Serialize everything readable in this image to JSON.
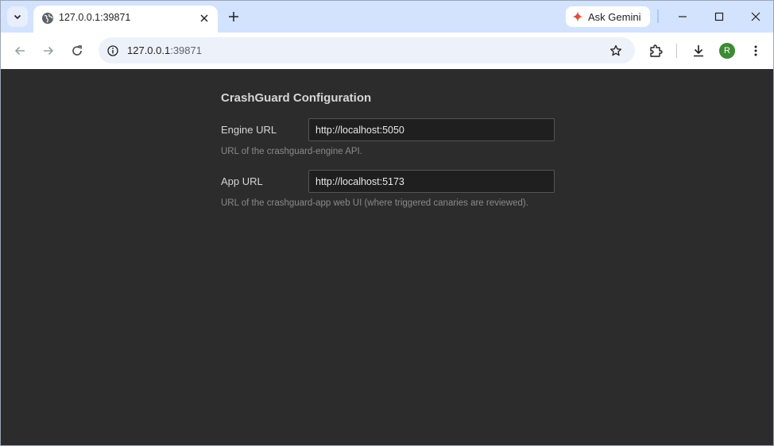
{
  "browser": {
    "tab": {
      "title": "127.0.0.1:39871"
    },
    "gemini_label": "Ask Gemini",
    "address": {
      "host": "127.0.0.1",
      "port": ":39871"
    },
    "profile_initial": "R"
  },
  "config": {
    "title": "CrashGuard Configuration",
    "fields": [
      {
        "label": "Engine URL",
        "value": "http://localhost:5050",
        "help": "URL of the crashguard-engine API."
      },
      {
        "label": "App URL",
        "value": "http://localhost:5173",
        "help": "URL of the crashguard-app web UI (where triggered canaries are reviewed)."
      }
    ]
  }
}
